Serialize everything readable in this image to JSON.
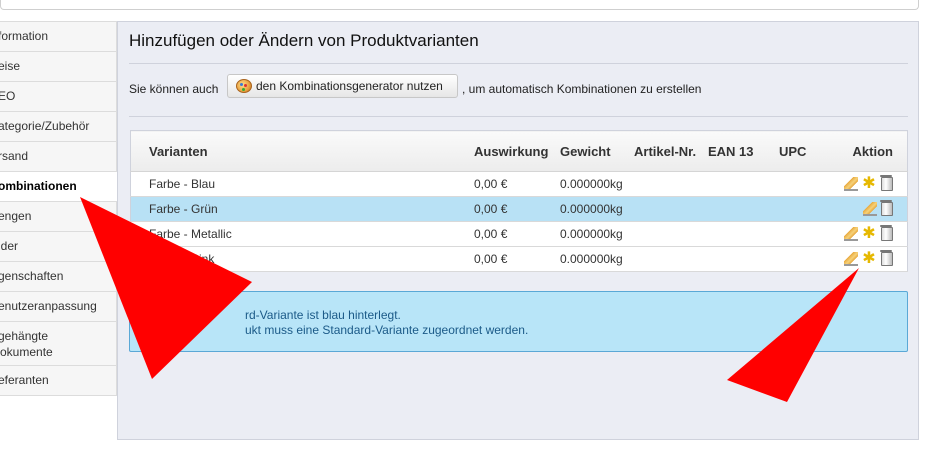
{
  "sidebar": {
    "items": [
      {
        "label": "formation"
      },
      {
        "label": "eise"
      },
      {
        "label": "EO"
      },
      {
        "label": "ategorie/Zubehör"
      },
      {
        "label": "rsand"
      },
      {
        "label": "ombinationen"
      },
      {
        "label": "engen"
      },
      {
        "label": "lder"
      },
      {
        "label": "genschaften"
      },
      {
        "label": "enutzeranpassung"
      },
      {
        "label": "gehängte\nokumente"
      },
      {
        "label": "eferanten"
      }
    ]
  },
  "main": {
    "title": "Hinzufügen oder Ändern von Produktvarianten",
    "generator": {
      "prefix": "Sie können auch",
      "button_label": "den Kombinationsgenerator nutzen",
      "suffix": ", um automatisch Kombinationen zu erstellen"
    },
    "table": {
      "headers": [
        "Varianten",
        "Auswirkung",
        "Gewicht",
        "Artikel-Nr.",
        "EAN 13",
        "UPC",
        "Aktion"
      ],
      "rows": [
        {
          "name": "Farbe - Blau",
          "impact": "0,00 €",
          "weight": "0.000000kg",
          "ref": "",
          "ean": "",
          "upc": ""
        },
        {
          "name": "Farbe - Grün",
          "impact": "0,00 €",
          "weight": "0.000000kg",
          "ref": "",
          "ean": "",
          "upc": ""
        },
        {
          "name": "Farbe - Metallic",
          "impact": "0,00 €",
          "weight": "0.000000kg",
          "ref": "",
          "ean": "",
          "upc": ""
        },
        {
          "name": "Farbe - Pink",
          "impact": "0,00 €",
          "weight": "0.000000kg",
          "ref": "",
          "ean": "",
          "upc": ""
        }
      ]
    },
    "info": {
      "line1": "rd-Variante ist blau hinterlegt.",
      "line2": "ukt muss eine Standard-Variante zugeordnet werden."
    }
  },
  "colors": {
    "highlight_row": "#b8e1f5",
    "info_bg": "#b8e5f8",
    "arrow": "#ff0000"
  },
  "icons": [
    "edit-icon",
    "set-default-star-icon",
    "delete-icon",
    "generator-palette-icon"
  ]
}
